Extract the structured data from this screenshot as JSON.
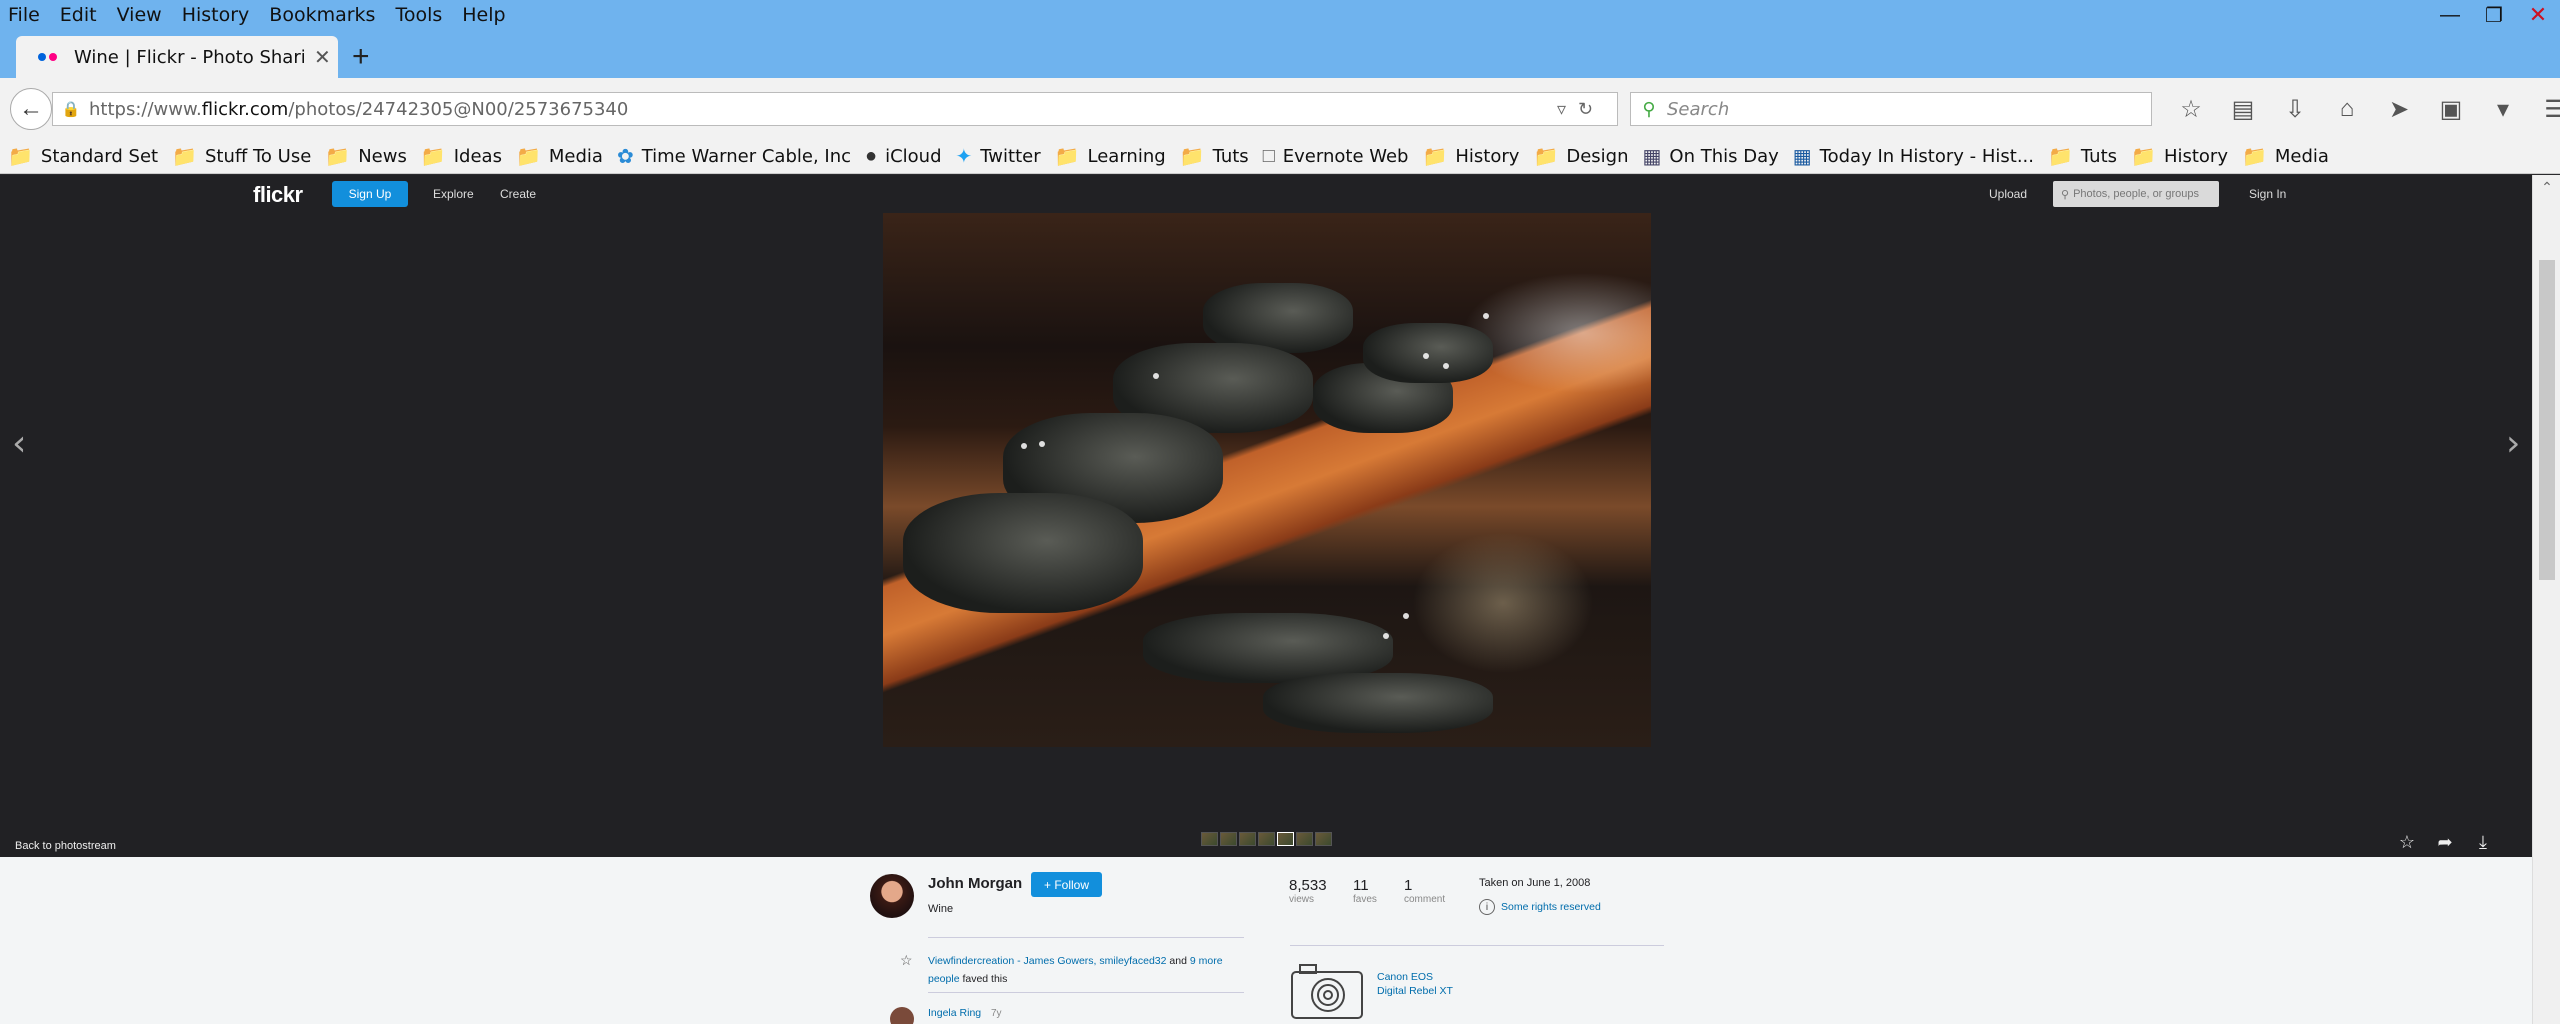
{
  "browser": {
    "menu": [
      "File",
      "Edit",
      "View",
      "History",
      "Bookmarks",
      "Tools",
      "Help"
    ],
    "tab_title": "Wine | Flickr - Photo Shari...",
    "url_prefix": "https://www.",
    "url_domain": "flickr.com",
    "url_path": "/photos/24742305@N00/2573675340",
    "search_placeholder": "Search",
    "bookmarks": [
      {
        "label": "Standard Set",
        "icon": "folder-icon"
      },
      {
        "label": "Stuff To Use",
        "icon": "folder-icon"
      },
      {
        "label": "News",
        "icon": "folder-icon"
      },
      {
        "label": "Ideas",
        "icon": "folder-icon"
      },
      {
        "label": "Media",
        "icon": "folder-icon"
      },
      {
        "label": "Time Warner Cable, Inc",
        "icon": "twc-icon"
      },
      {
        "label": "iCloud",
        "icon": "apple-icon"
      },
      {
        "label": "Twitter",
        "icon": "twitter-icon"
      },
      {
        "label": "Learning",
        "icon": "folder-icon"
      },
      {
        "label": "Tuts",
        "icon": "folder-icon"
      },
      {
        "label": "Evernote Web",
        "icon": "page-icon"
      },
      {
        "label": "History",
        "icon": "folder-icon"
      },
      {
        "label": "Design",
        "icon": "folder-icon"
      },
      {
        "label": "On This Day",
        "icon": "site-icon"
      },
      {
        "label": "Today In History - Hist...",
        "icon": "site-icon"
      },
      {
        "label": "Tuts",
        "icon": "folder-icon"
      },
      {
        "label": "History",
        "icon": "folder-icon"
      },
      {
        "label": "Media",
        "icon": "folder-icon"
      }
    ]
  },
  "flickr": {
    "logo": "flickr",
    "signup": "Sign Up",
    "explore": "Explore",
    "create": "Create",
    "upload": "Upload",
    "search_placeholder": "Photos, people, or groups",
    "signin": "Sign In",
    "back_to_photostream": "Back to photostream",
    "owner": "John Morgan",
    "follow": "+ Follow",
    "photo_title": "Wine",
    "faves_links": "Viewfindercreation - James Gowers, smileyfaced32",
    "faves_and": " and ",
    "faves_more": "9 more people",
    "faves_suffix": " faved this",
    "comment_author": "Ingela Ring",
    "comment_age": "7y",
    "stats": [
      {
        "value": "8,533",
        "label": "views"
      },
      {
        "value": "11",
        "label": "faves"
      },
      {
        "value": "1",
        "label": "comment"
      }
    ],
    "taken": "Taken on June 1, 2008",
    "rights": "Some rights reserved",
    "camera_line1": "Canon EOS",
    "camera_line2": "Digital Rebel XT"
  },
  "colors": {
    "accent": "#128fdc",
    "link": "#006dac",
    "dark": "#212124",
    "browser_chrome": "#6fb3ee"
  }
}
